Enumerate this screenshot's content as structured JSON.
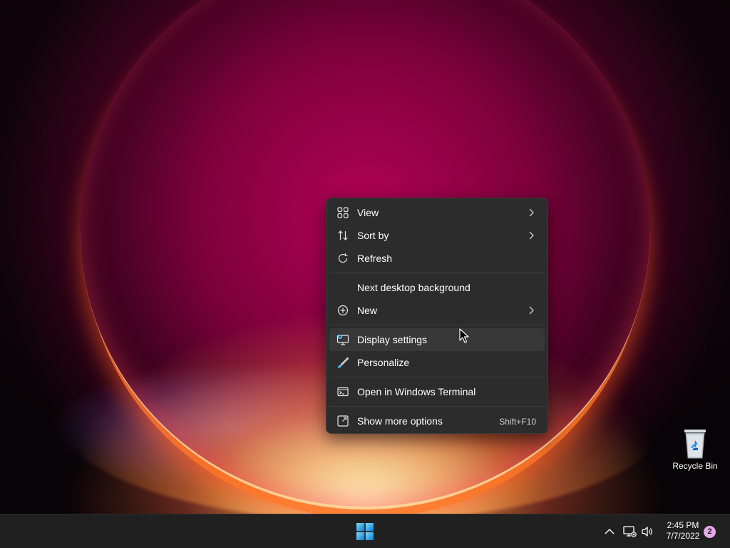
{
  "desktop": {
    "recycle_bin_label": "Recycle Bin"
  },
  "context_menu": {
    "items": [
      {
        "label": "View",
        "icon": "grid-view-icon",
        "submenu": true
      },
      {
        "label": "Sort by",
        "icon": "sort-arrows-icon",
        "submenu": true
      },
      {
        "label": "Refresh",
        "icon": "refresh-icon",
        "submenu": false
      },
      {
        "label": "Next desktop background",
        "icon": "",
        "submenu": false
      },
      {
        "label": "New",
        "icon": "plus-circle-icon",
        "submenu": true
      },
      {
        "label": "Display settings",
        "icon": "display-settings-icon",
        "submenu": false,
        "hovered": true
      },
      {
        "label": "Personalize",
        "icon": "brush-icon",
        "submenu": false
      },
      {
        "label": "Open in Windows Terminal",
        "icon": "terminal-icon",
        "submenu": false
      },
      {
        "label": "Show more options",
        "icon": "expand-icon",
        "submenu": false,
        "shortcut": "Shift+F10"
      }
    ]
  },
  "taskbar": {
    "time": "2:45 PM",
    "date": "7/7/2022",
    "notification_count": "2",
    "start_icon": "windows-logo-icon",
    "tray_icons": [
      "chevron-up-icon",
      "network-icon",
      "volume-icon"
    ]
  },
  "colors": {
    "menu_bg": "#2c2c2c",
    "menu_hover": "#383838",
    "taskbar_bg": "#202020",
    "accent": "#4cc2ff",
    "badge": "#e3a9e8"
  }
}
